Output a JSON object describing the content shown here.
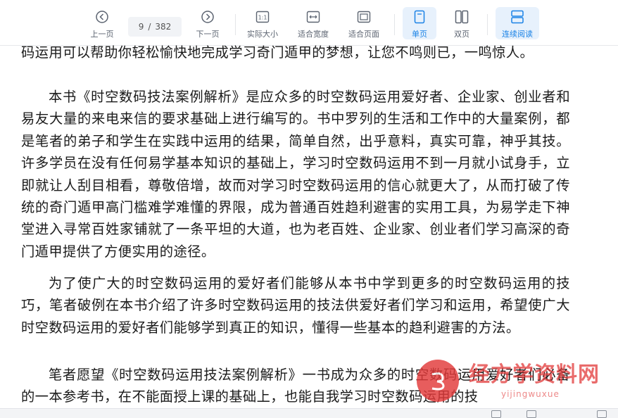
{
  "toolbar": {
    "prev_page": "上一页",
    "next_page": "下一页",
    "current_page": "9",
    "page_separator": "/",
    "total_pages": "382",
    "actual_size": "实际大小",
    "fit_width": "适合宽度",
    "fit_page": "适合页面",
    "single_page": "单页",
    "double_page": "双页",
    "continuous_reading": "连续阅读",
    "active_color": "#1a82e6"
  },
  "document": {
    "paragraphs": [
      "码运用可以帮助你轻松愉快地完成学习奇门遁甲的梦想，让您不鸣则已，一鸣惊人。",
      "本书《时空数码技法案例解析》是应众多的时空数码运用爱好者、企业家、创业者和易友大量的来电来信的要求基础上进行编写的。书中罗列的生活和工作中的大量案例，都是笔者的弟子和学生在实践中运用的结果，简单自然，出乎意料，真实可靠，神乎其技。许多学员在没有任何易学基本知识的基础上，学习时空数码运用不到一月就小试身手，立即就让人刮目相看，尊敬倍增，故而对学习时空数码运用的信心就更大了，从而打破了传统的奇门遁甲高门槛难学难懂的界限，成为普通百姓趋利避害的实用工具，为易学走下神堂进入寻常百姓家铺就了一条平坦的大道，也为老百姓、企业家、创业者们学习高深的奇门遁甲提供了方便实用的途径。",
      "为了使广大的时空数码运用的爱好者们能够从本书中学到更多的时空数码运用的技巧，笔者破例在本书介绍了许多时空数码运用的技法供爱好者们学习和运用，希望使广大时空数码运用的爱好者们能够学到真正的知识，懂得一些基本的趋利避害的方法。",
      "笔者愿望《时空数码运用技法案例解析》一书成为众多的时空数码运用爱好者们必备的一本参考书，在不能面授上课的基础上，也能自我学习时空数码运用的技"
    ]
  },
  "watermark": {
    "brand": "经方学资料网",
    "url": "yijingwuxue",
    "color": "#e23a3a"
  }
}
